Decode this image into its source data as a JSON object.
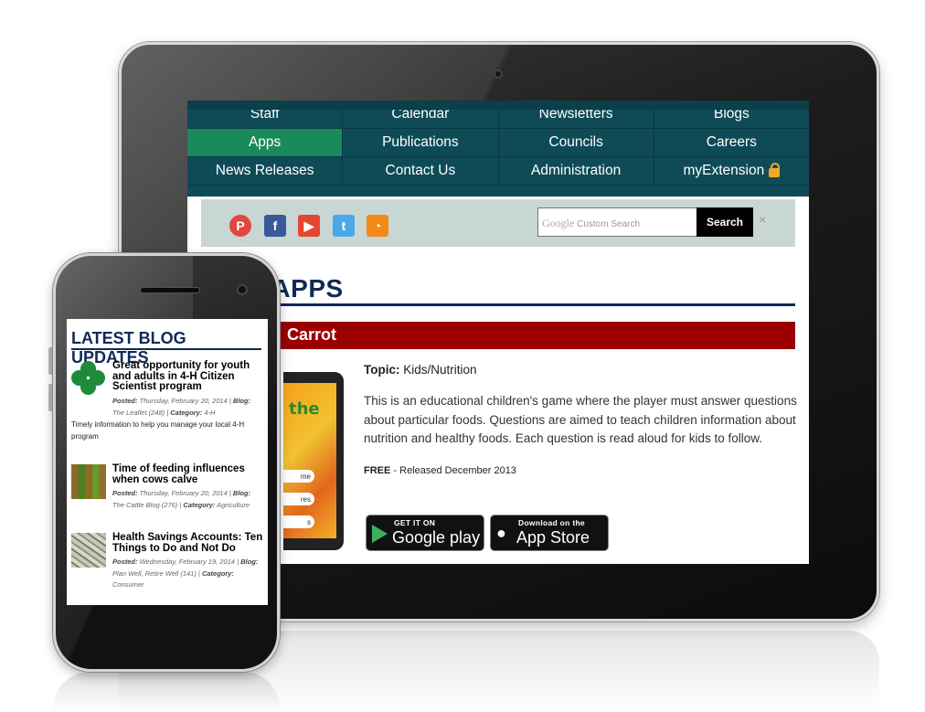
{
  "tablet": {
    "nav": [
      [
        "Staff",
        "Calendar",
        "Newsletters",
        "Blogs"
      ],
      [
        "Apps",
        "Publications",
        "Councils",
        "Careers"
      ],
      [
        "News Releases",
        "Contact Us",
        "Administration",
        "myExtension"
      ]
    ],
    "active_nav": "Apps",
    "social": [
      "pinterest-icon",
      "facebook-icon",
      "youtube-icon",
      "twitter-icon",
      "rss-icon"
    ],
    "search": {
      "hint_brand": "Google",
      "hint_text": "Custom Search",
      "button_label": "Search",
      "clear_label": "×"
    },
    "page_heading": "E APPS",
    "app": {
      "title": "Carrot",
      "topic_label": "Topic:",
      "topic_value": "Kids/Nutrition",
      "description": "This is an educational children's game where the player must answer questions about particular foods. Questions are aimed to teach children information about nutrition and healthy foods. Each question is read aloud for kids to follow.",
      "price_label": "FREE",
      "release_text": "- Released December 2013",
      "thumb_text": "the",
      "thumb_buttons": [
        "me",
        "res",
        "s"
      ],
      "google_play": {
        "small": "GET IT ON",
        "big": "Google play"
      },
      "app_store": {
        "small": "Download on the",
        "big": "App Store"
      }
    }
  },
  "phone": {
    "heading": "LATEST BLOG UPDATES",
    "posts": [
      {
        "title": "Great opportunity for youth and adults in 4-H Citizen Scientist program",
        "meta_posted_label": "Posted:",
        "meta_posted": "Thursday, February 20, 2014",
        "meta_blog_label": "Blog:",
        "meta_blog": "The Leaflet (248)",
        "meta_cat_label": "Category:",
        "meta_cat": "4-H",
        "excerpt": "Timely information to help you manage your local 4-H program",
        "thumb": "clover-icon"
      },
      {
        "title": "Time of feeding influences when cows calve",
        "meta_posted_label": "Posted:",
        "meta_posted": "Thursday, February 20, 2014",
        "meta_blog_label": "Blog:",
        "meta_blog": "The Cattle Blog (276)",
        "meta_cat_label": "Category:",
        "meta_cat": "Agriculture",
        "thumb": "field-photo"
      },
      {
        "title": "Health Savings Accounts: Ten Things to Do and Not Do",
        "meta_posted_label": "Posted:",
        "meta_posted": "Wednesday, February 19, 2014",
        "meta_blog_label": "Blog:",
        "meta_blog": "Plan Well, Retire Well (141)",
        "meta_cat_label": "Category:",
        "meta_cat": "Consumer",
        "thumb": "money-photo"
      }
    ]
  },
  "colors": {
    "nav_bg": "#0e4b57",
    "nav_active": "#1a8a5d",
    "heading_navy": "#0f2a55",
    "app_bar_red": "#9a0000",
    "social_bar": "#c8d6d4"
  }
}
